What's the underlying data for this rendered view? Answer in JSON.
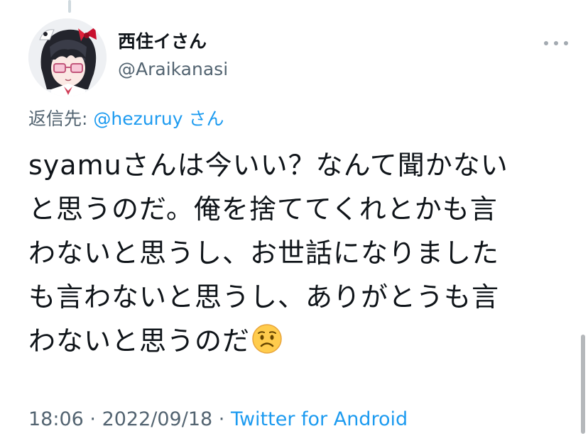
{
  "user": {
    "display_name": "西住イさん",
    "handle": "@Araikanasi"
  },
  "reply": {
    "prefix": "返信先: ",
    "mention": "@hezuruy",
    "suffix": " さん"
  },
  "tweet": {
    "lines": [
      "syamuさんは今いい？なんて聞かない",
      "と思うのだ。俺を捨ててくれとかも言",
      "わないと思うし、お世話になりました",
      "も言わないと思うし、ありがとうも言",
      "わないと思うのだ"
    ],
    "emoji": "worried-face"
  },
  "meta": {
    "time": "18:06",
    "separator1": " · ",
    "date": "2022/09/18",
    "separator2": " · ",
    "source": "Twitter for Android"
  },
  "colors": {
    "link": "#1d9bf0",
    "secondary": "#536471",
    "text": "#0f1419"
  }
}
